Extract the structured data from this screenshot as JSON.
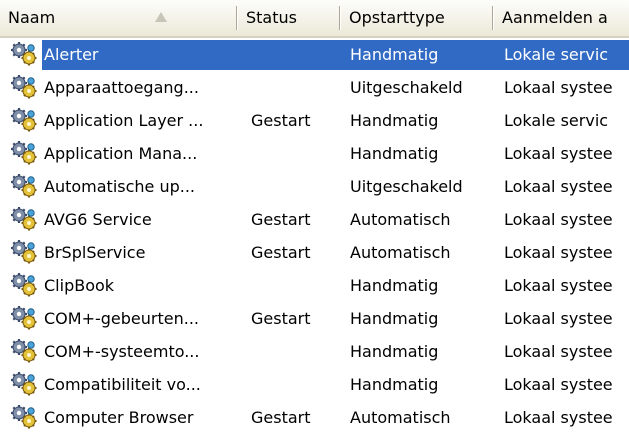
{
  "columns": {
    "name": "Naam",
    "status": "Status",
    "startup": "Opstarttype",
    "logon": "Aanmelden a"
  },
  "icon": "gears-icon",
  "colors": {
    "selection": "#316ac5",
    "header_bg": "#ece9d8"
  },
  "services": [
    {
      "name": "Alerter",
      "status": "",
      "startup": "Handmatig",
      "logon": "Lokale servic",
      "selected": true
    },
    {
      "name": "Apparaattoegang...",
      "status": "",
      "startup": "Uitgeschakeld",
      "logon": "Lokaal systee"
    },
    {
      "name": "Application Layer ...",
      "status": "Gestart",
      "startup": "Handmatig",
      "logon": "Lokale servic"
    },
    {
      "name": "Application Mana...",
      "status": "",
      "startup": "Handmatig",
      "logon": "Lokaal systee"
    },
    {
      "name": "Automatische up...",
      "status": "",
      "startup": "Uitgeschakeld",
      "logon": "Lokaal systee"
    },
    {
      "name": "AVG6 Service",
      "status": "Gestart",
      "startup": "Automatisch",
      "logon": "Lokaal systee"
    },
    {
      "name": "BrSplService",
      "status": "Gestart",
      "startup": "Automatisch",
      "logon": "Lokaal systee"
    },
    {
      "name": "ClipBook",
      "status": "",
      "startup": "Handmatig",
      "logon": "Lokaal systee"
    },
    {
      "name": "COM+-gebeurten...",
      "status": "Gestart",
      "startup": "Handmatig",
      "logon": "Lokaal systee"
    },
    {
      "name": "COM+-systeemto...",
      "status": "",
      "startup": "Handmatig",
      "logon": "Lokaal systee"
    },
    {
      "name": "Compatibiliteit vo...",
      "status": "",
      "startup": "Handmatig",
      "logon": "Lokaal systee"
    },
    {
      "name": "Computer Browser",
      "status": "Gestart",
      "startup": "Automatisch",
      "logon": "Lokaal systee"
    }
  ]
}
